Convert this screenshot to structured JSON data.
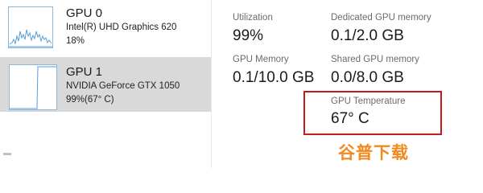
{
  "gpu_list": [
    {
      "name": "GPU 0",
      "model": "Intel(R) UHD Graphics 620",
      "usage": "18%"
    },
    {
      "name": "GPU 1",
      "model": "NVIDIA GeForce GTX 1050",
      "usage": "99%(67° C)"
    }
  ],
  "stats": {
    "utilization_label": "Utilization",
    "utilization_value": "99%",
    "dedicated_label": "Dedicated GPU memory",
    "dedicated_value": "0.1/2.0 GB",
    "gpu_memory_label": "GPU Memory",
    "gpu_memory_value": "0.1/10.0 GB",
    "shared_label": "Shared GPU memory",
    "shared_value": "0.0/8.0 GB",
    "temperature_label": "GPU Temperature",
    "temperature_value": "67° C"
  },
  "watermark": "谷普下载",
  "colors": {
    "selected_bg": "#d9d9d9",
    "graph_line": "#5a9bd4",
    "highlight_border": "#c41b1b",
    "watermark": "#f08a1e"
  }
}
